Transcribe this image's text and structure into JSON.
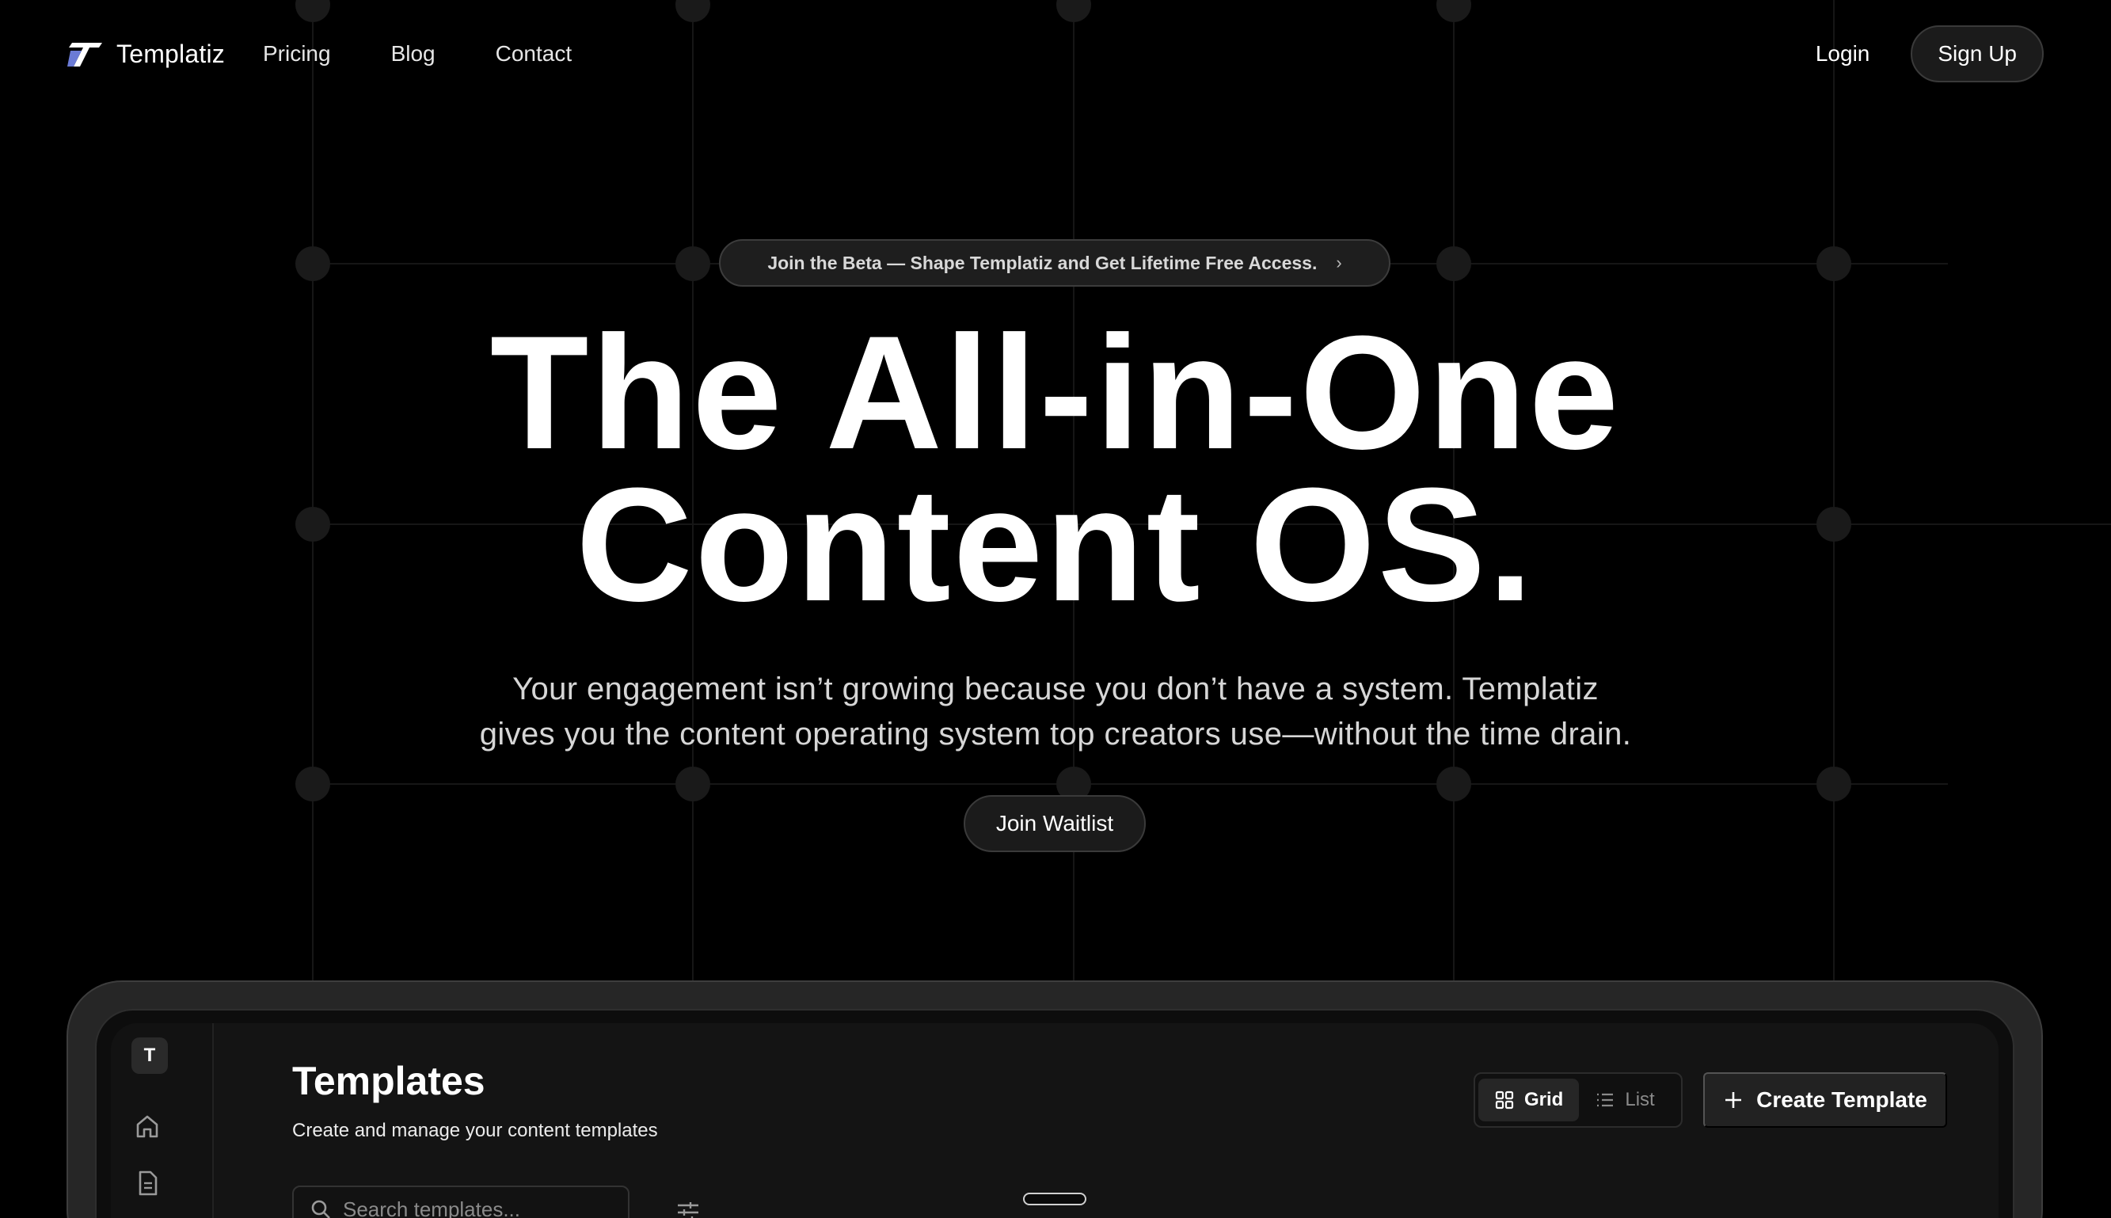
{
  "nav": {
    "brand": "Templatiz",
    "links": [
      "Pricing",
      "Blog",
      "Contact"
    ],
    "login": "Login",
    "signup": "Sign Up"
  },
  "hero": {
    "badge": "Join the Beta — Shape Templatiz and Get Lifetime Free Access.",
    "headline_line1": "The All-in-One",
    "headline_line2": "Content OS.",
    "subtitle_line1": "Your engagement isn’t growing because you don’t have a system. Templatiz",
    "subtitle_line2": "gives you the content operating system top creators use—without the time drain.",
    "cta": "Join Waitlist"
  },
  "app": {
    "sidebar_logo": "T",
    "title": "Templates",
    "subtitle": "Create and manage your content templates",
    "view_toggle": {
      "grid": "Grid",
      "list": "List",
      "selected": "Grid"
    },
    "create_button": "Create Template",
    "search_placeholder": "Search templates..."
  },
  "colors": {
    "background": "#000000",
    "surface": "#141414",
    "button": "#1b1b1b",
    "border": "#3a3a3a",
    "logo_accent": "#6b7bd6"
  },
  "icons": [
    "logo-mark-icon",
    "chevron-right-icon",
    "home-icon",
    "document-icon",
    "grid-icon",
    "list-icon",
    "plus-icon",
    "search-icon",
    "sliders-icon"
  ]
}
